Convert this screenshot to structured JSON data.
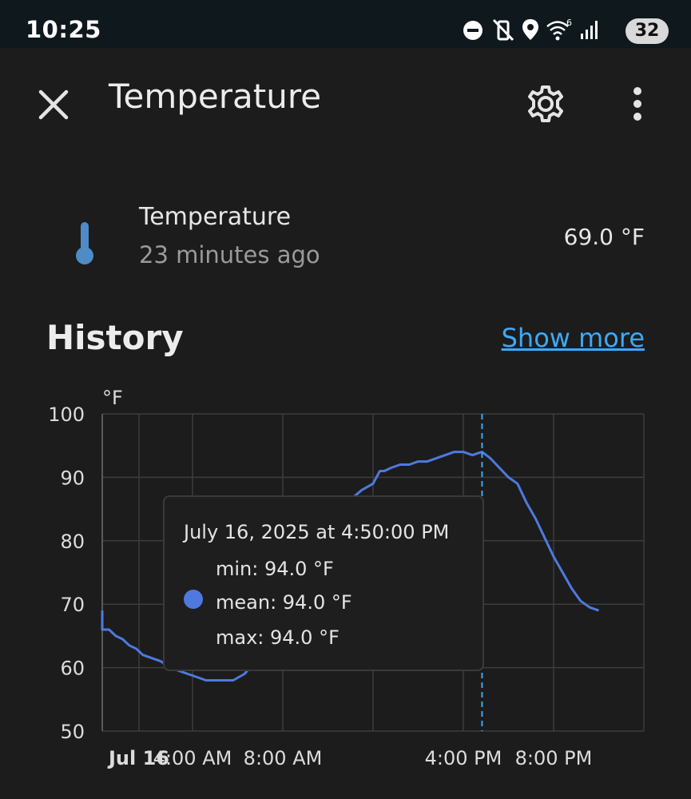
{
  "status_bar": {
    "time": "10:25",
    "battery": "32",
    "icons": [
      "do-not-disturb-icon",
      "vibrate-off-icon",
      "location-icon",
      "wifi-6-icon",
      "signal-icon"
    ]
  },
  "app_bar": {
    "title": "Temperature",
    "icons": [
      "close-icon",
      "gear-icon",
      "more-vertical-icon"
    ]
  },
  "entity": {
    "name": "Temperature",
    "last_changed": "23 minutes ago",
    "value": "69.0 °F",
    "icon": "thermometer-icon",
    "icon_color": "#4e8bc7"
  },
  "history": {
    "title": "History",
    "show_more_label": "Show more",
    "link_color": "#3ea9f5"
  },
  "chart_data": {
    "type": "line",
    "ylabel": "°F",
    "ylim": [
      50,
      100
    ],
    "yticks": [
      50,
      60,
      70,
      80,
      90,
      100
    ],
    "xlim": [
      0,
      24
    ],
    "x_unit": "hours after Jul 16 12:00 AM",
    "xticks": [
      {
        "x": 0,
        "label": "Jul 16",
        "bold": true
      },
      {
        "x": 4,
        "label": "4:00 AM",
        "bold": false
      },
      {
        "x": 8,
        "label": "8:00 AM",
        "bold": false
      },
      {
        "x": 12,
        "label": "",
        "bold": false
      },
      {
        "x": 16,
        "label": "4:00 PM",
        "bold": false
      },
      {
        "x": 20,
        "label": "8:00 PM",
        "bold": false
      }
    ],
    "grid": true,
    "line_color": "#4f79df",
    "cursor_x": 16.83,
    "cursor_color": "#3ea9f5",
    "series": [
      {
        "values_x": [
          -1.6,
          -1.2,
          -0.8,
          -0.4,
          0.0,
          0.3,
          0.6,
          0.9,
          1.2,
          1.5,
          1.8,
          2.2,
          2.6,
          3.0,
          3.4,
          3.8,
          4.2,
          4.6,
          5.0,
          5.4,
          5.8,
          6.3,
          6.8,
          7.0,
          7.3,
          7.6,
          8.0,
          8.5,
          9.0,
          9.5,
          10.0,
          10.5,
          11.0,
          11.5,
          12.0,
          12.3,
          12.5,
          12.8,
          13.2,
          13.6,
          14.0,
          14.4,
          14.8,
          15.2,
          15.6,
          16.0,
          16.4,
          16.83,
          17.2,
          17.6,
          18.0,
          18.4,
          18.8,
          19.2,
          19.6,
          20.0,
          20.4,
          20.8,
          21.2,
          21.6,
          22.0
        ],
        "values_y": [
          69.0,
          68.0,
          68.0,
          66.5,
          66.0,
          66.0,
          65.0,
          64.5,
          63.5,
          63.0,
          62.0,
          61.5,
          61.0,
          60.0,
          59.5,
          59.0,
          58.5,
          58.0,
          58.0,
          58.0,
          58.0,
          59.0,
          61.0,
          63.0,
          65.0,
          67.0,
          69.0,
          72.0,
          75.0,
          78.0,
          81.0,
          84.0,
          86.5,
          88.0,
          89.0,
          91.0,
          91.0,
          91.5,
          92.0,
          92.0,
          92.5,
          92.5,
          93.0,
          93.5,
          94.0,
          94.0,
          93.5,
          94.0,
          93.0,
          91.5,
          90.0,
          89.0,
          86.0,
          83.5,
          80.5,
          77.5,
          75.0,
          72.5,
          70.5,
          69.5,
          69.0
        ]
      }
    ],
    "tooltip": {
      "date": "July 16, 2025 at 4:50:00 PM",
      "min": "min: 94.0 °F",
      "mean": "mean: 94.0 °F",
      "max": "max: 94.0 °F",
      "dot_color": "#4f79df"
    }
  }
}
